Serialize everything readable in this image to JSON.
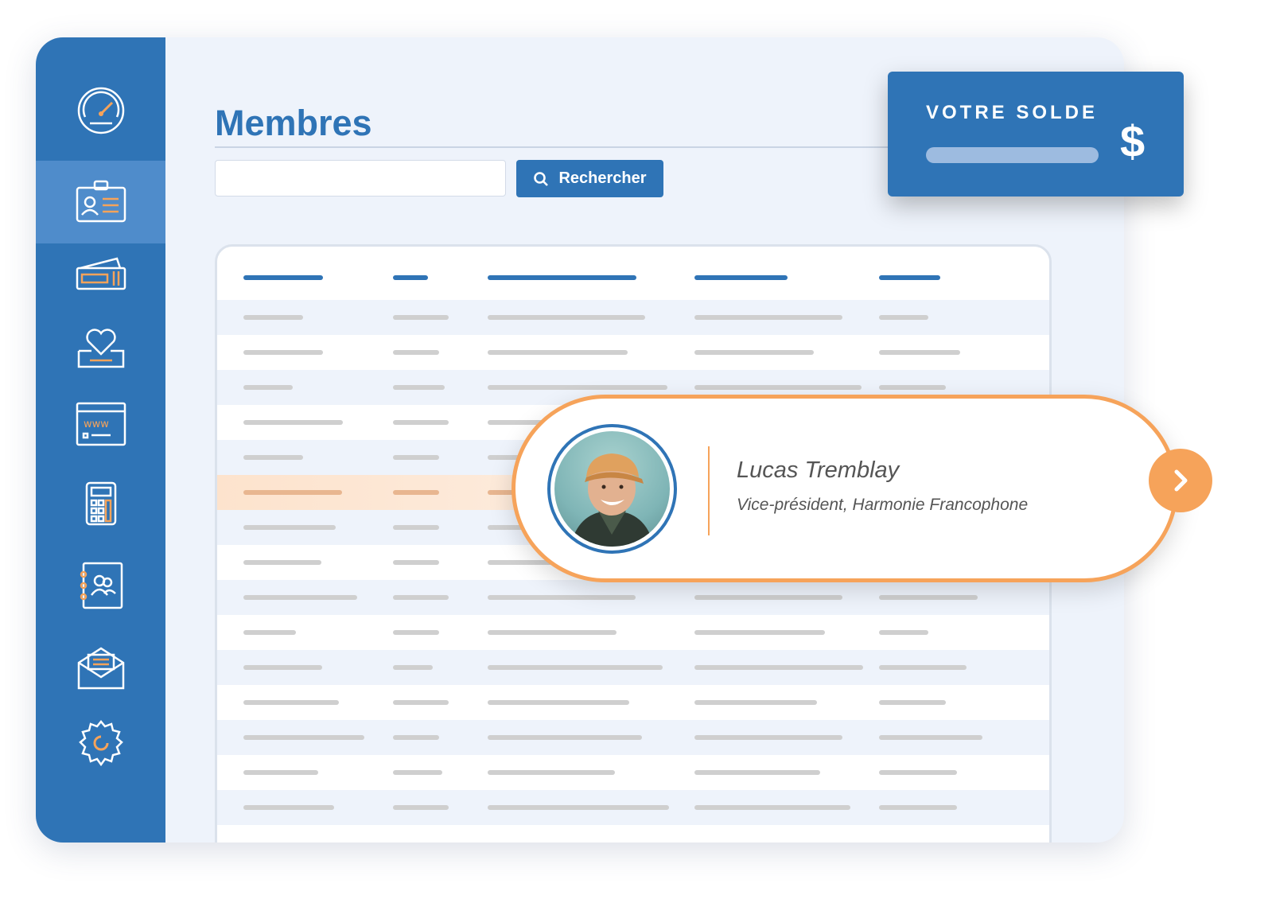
{
  "page": {
    "title": "Membres"
  },
  "sidebar": {
    "items": [
      {
        "icon": "dashboard-gauge-icon"
      },
      {
        "icon": "member-card-icon",
        "active": true
      },
      {
        "icon": "tickets-icon"
      },
      {
        "icon": "donation-box-icon"
      },
      {
        "icon": "website-www-icon"
      },
      {
        "icon": "calculator-icon"
      },
      {
        "icon": "contacts-book-icon"
      },
      {
        "icon": "mail-envelope-icon"
      },
      {
        "icon": "settings-gear-icon"
      }
    ]
  },
  "search": {
    "value": "",
    "placeholder": "",
    "button_label": "Rechercher"
  },
  "balance": {
    "label": "VOTRE SOLDE",
    "currency": "$"
  },
  "member": {
    "name": "Lucas Tremblay",
    "role": "Vice-président, Harmonie Francophone"
  },
  "colors": {
    "primary": "#2f74b6",
    "accent": "#f6a35a",
    "background": "#eef3fb"
  }
}
